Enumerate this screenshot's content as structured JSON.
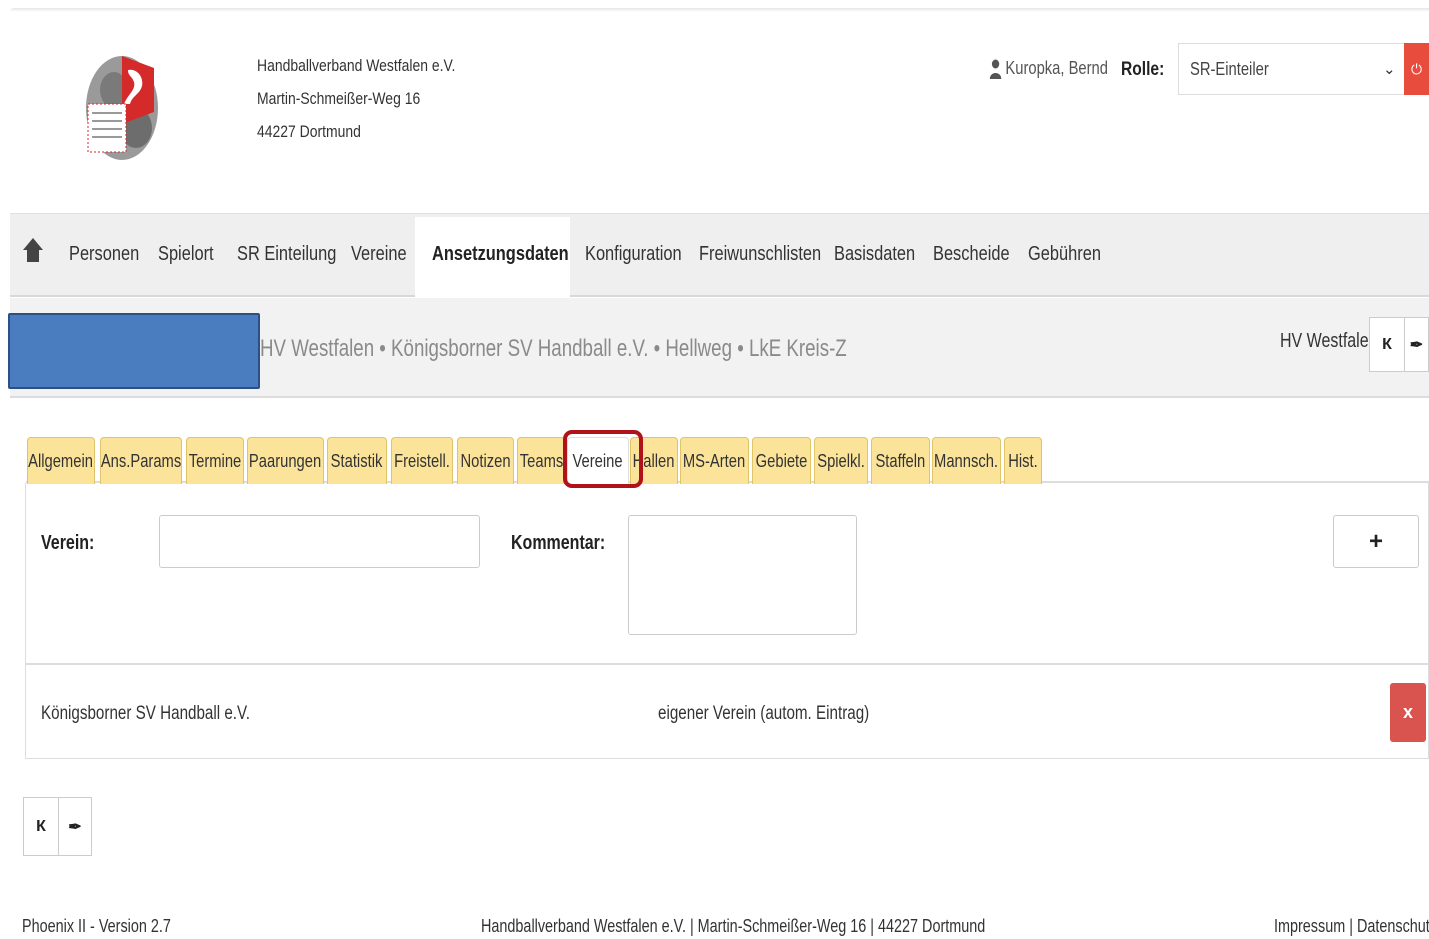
{
  "header": {
    "org_name": "Handballverband Westfalen e.V.",
    "org_street": "Martin-Schmeißer-Weg 16",
    "org_city": "44227 Dortmund",
    "user_name": "Kuropka, Bernd",
    "role_label": "Rolle:",
    "role_value": "SR-Einteiler"
  },
  "nav": {
    "items": [
      "Personen",
      "Spielort",
      "SR Einteilung",
      "Vereine",
      "Ansetzungsdaten",
      "Konfiguration",
      "Freiwunschlisten",
      "Basisdaten",
      "Bescheide",
      "Gebühren"
    ],
    "active": "Ansetzungsdaten"
  },
  "breadcrumb": {
    "path": "HV Westfalen • Königsborner SV Handball e.V. • Hellweg •    LkE Kreis-Z",
    "right_label": "HV Westfalen"
  },
  "tabs": [
    "Allgemein",
    "Ans.Params",
    "Termine",
    "Paarungen",
    "Statistik",
    "Freistell.",
    "Notizen",
    "Teams",
    "Vereine",
    "Hallen",
    "MS-Arten",
    "Gebiete",
    "Spielkl.",
    "Staffeln",
    "Mannsch.",
    "Hist."
  ],
  "active_tab": "Vereine",
  "form": {
    "verein_label": "Verein:",
    "verein_value": "",
    "kommentar_label": "Kommentar:",
    "kommentar_value": "",
    "add_symbol": "+"
  },
  "rows": [
    {
      "verein": "Königsborner SV Handball e.V.",
      "kommentar": "eigener Verein (autom. Eintrag)",
      "delete_symbol": "x"
    }
  ],
  "footer": {
    "version": "Phoenix II - Version 2.7",
    "address": "Handballverband Westfalen e.V. | Martin-Schmeißer-Weg 16 | 44227 Dortmund",
    "links": "Impressum | Datenschutz"
  },
  "colors": {
    "tab_bg": "#fbe49a",
    "danger": "#d9534f",
    "highlight": "#b0121a",
    "redaction": "#4a7dbf"
  }
}
